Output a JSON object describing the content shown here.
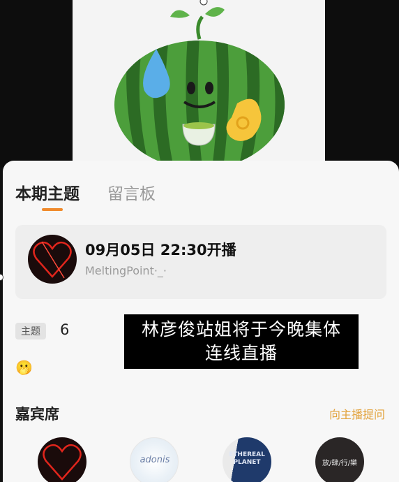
{
  "tabs": {
    "current": "本期主题",
    "board": "留言板"
  },
  "live": {
    "time": "09月05日 22:30开播",
    "host": "MeltingPoint·_·"
  },
  "topic": {
    "badge": "主题",
    "count": "6",
    "emoji": "🫢"
  },
  "caption": {
    "line1": "林彦俊站姐将于今晚集体",
    "line2": "连线直播"
  },
  "guests": {
    "title": "嘉宾席",
    "ask_label": "向主播提问",
    "items": [
      {
        "label": ""
      },
      {
        "label": "adonis"
      },
      {
        "label": "ETHEREAL PLANET"
      },
      {
        "label": "放/肆/行/樂"
      }
    ]
  },
  "colors": {
    "accent": "#f08a2c",
    "link": "#e2a23b"
  }
}
